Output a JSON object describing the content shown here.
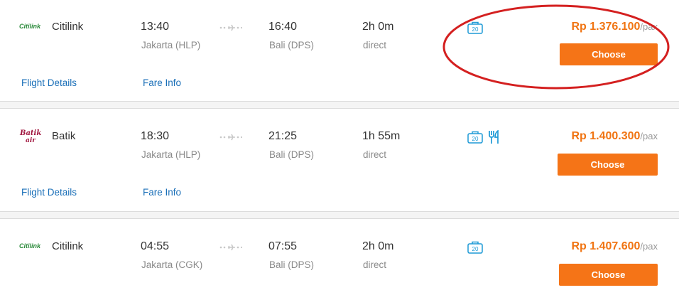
{
  "flights": [
    {
      "airline": "Citilink",
      "logo_text": "Citilink",
      "dep_time": "13:40",
      "dep_airport": "Jakarta (HLP)",
      "arr_time": "16:40",
      "arr_airport": "Bali (DPS)",
      "duration": "2h 0m",
      "stops": "direct",
      "baggage": "20",
      "meal": false,
      "price": "Rp 1.376.100",
      "per": "/pax",
      "choose_label": "Choose",
      "flight_details_label": "Flight Details",
      "fare_info_label": "Fare Info"
    },
    {
      "airline": "Batik",
      "logo_text": "Batik air",
      "dep_time": "18:30",
      "dep_airport": "Jakarta (HLP)",
      "arr_time": "21:25",
      "arr_airport": "Bali (DPS)",
      "duration": "1h 55m",
      "stops": "direct",
      "baggage": "20",
      "meal": true,
      "price": "Rp 1.400.300",
      "per": "/pax",
      "choose_label": "Choose",
      "flight_details_label": "Flight Details",
      "fare_info_label": "Fare Info"
    },
    {
      "airline": "Citilink",
      "logo_text": "Citilink",
      "dep_time": "04:55",
      "dep_airport": "Jakarta (CGK)",
      "arr_time": "07:55",
      "arr_airport": "Bali (DPS)",
      "duration": "2h 0m",
      "stops": "direct",
      "baggage": "20",
      "meal": false,
      "price": "Rp 1.407.600",
      "per": "/pax",
      "choose_label": "Choose"
    }
  ],
  "colors": {
    "price": "#f07412",
    "button": "#f57417",
    "link": "#1a6fb8",
    "icon": "#1e9ad6",
    "highlight": "#d42020",
    "citilink": "#2a8a3a",
    "batik": "#a0153e"
  }
}
